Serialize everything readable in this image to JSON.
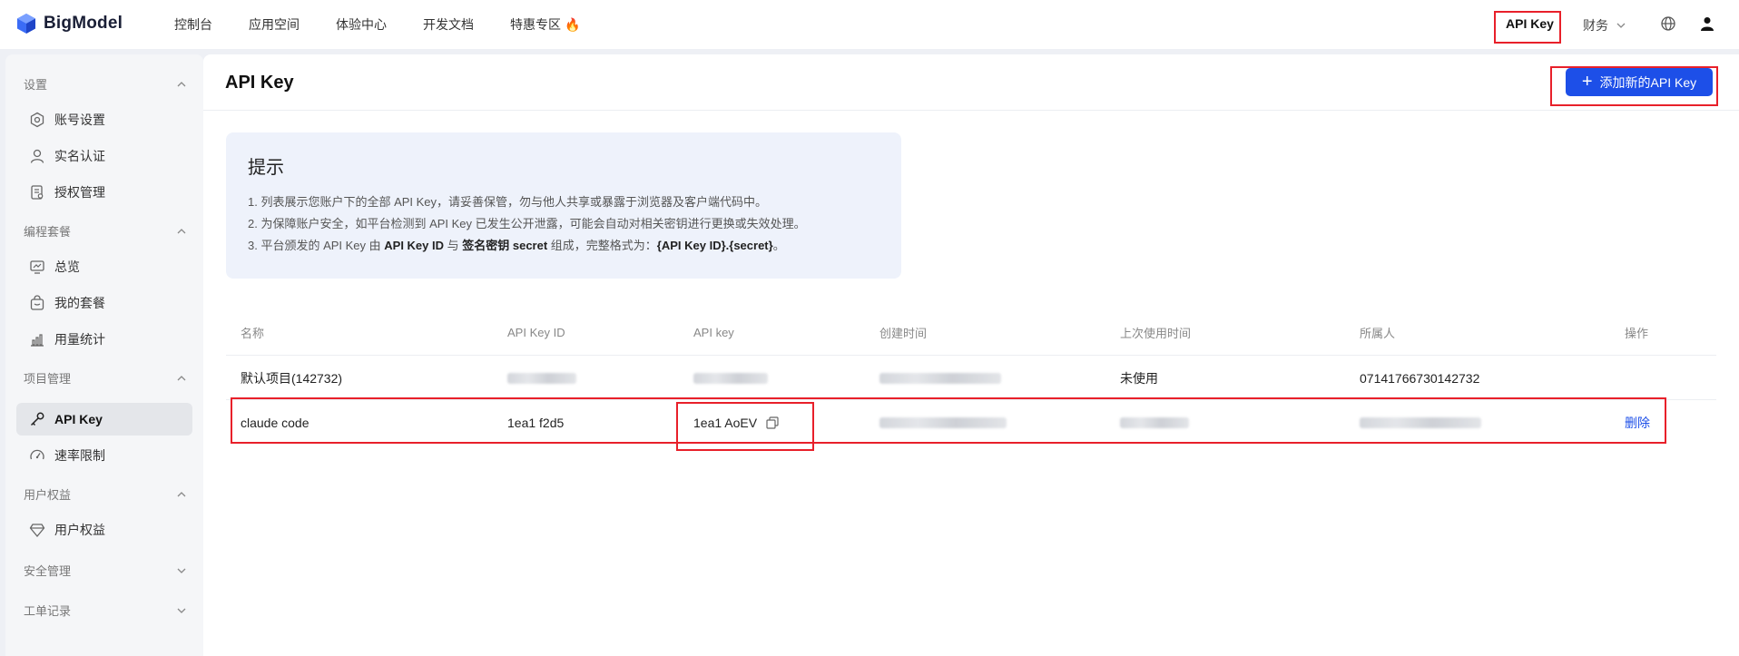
{
  "brand": {
    "name": "BigModel",
    "accent": "#1d4fe8",
    "highlight": "#e8202a"
  },
  "topnav": [
    {
      "label": "控制台"
    },
    {
      "label": "应用空间"
    },
    {
      "label": "体验中心"
    },
    {
      "label": "开发文档"
    },
    {
      "label": "特惠专区",
      "icon": "fire-icon"
    }
  ],
  "topright": {
    "api_key": "API Key",
    "finance": "财务",
    "globe_icon": "globe-icon",
    "user_icon": "user-icon"
  },
  "sidebar": {
    "groups": [
      {
        "label": "设置",
        "expanded": true,
        "items": [
          {
            "label": "账号设置",
            "icon": "gear-icon"
          },
          {
            "label": "实名认证",
            "icon": "person-icon"
          },
          {
            "label": "授权管理",
            "icon": "document-icon"
          }
        ]
      },
      {
        "label": "编程套餐",
        "expanded": true,
        "items": [
          {
            "label": "总览",
            "icon": "monitor-icon"
          },
          {
            "label": "我的套餐",
            "icon": "bag-icon"
          },
          {
            "label": "用量统计",
            "icon": "chart-icon"
          }
        ]
      },
      {
        "label": "项目管理",
        "expanded": true,
        "items": [
          {
            "label": "API Key",
            "icon": "key-icon",
            "active": true
          },
          {
            "label": "速率限制",
            "icon": "gauge-icon"
          }
        ]
      },
      {
        "label": "用户权益",
        "expanded": true,
        "items": [
          {
            "label": "用户权益",
            "icon": "diamond-icon"
          }
        ]
      },
      {
        "label": "安全管理",
        "expanded": false,
        "items": []
      },
      {
        "label": "工单记录",
        "expanded": false,
        "items": []
      }
    ]
  },
  "main": {
    "title": "API Key",
    "add_button": "添加新的API Key",
    "tip": {
      "title": "提示",
      "line1": "1. 列表展示您账户下的全部 API Key，请妥善保管，勿与他人共享或暴露于浏览器及客户端代码中。",
      "line2": "2. 为保障账户安全，如平台检测到 API Key 已发生公开泄露，可能会自动对相关密钥进行更换或失效处理。",
      "line3_a": "3. 平台颁发的 API Key 由 ",
      "line3_b": "API Key ID",
      "line3_c": " 与 ",
      "line3_d": "签名密钥 secret",
      "line3_e": " 组成，完整格式为：",
      "line3_f": "{API Key ID}.{secret}",
      "line3_g": "。"
    },
    "table": {
      "headers": [
        "名称",
        "API Key ID",
        "API key",
        "创建时间",
        "上次使用时间",
        "所属人",
        "操作"
      ],
      "rows": [
        {
          "name": "默认项目(142732)",
          "key_id": "",
          "api_key": "",
          "created": "",
          "last_used": "未使用",
          "owner": "07141766730142732",
          "action": ""
        },
        {
          "name": "claude code",
          "key_id": "1ea1 f2d5",
          "api_key": "1ea1 AoEV",
          "created": "",
          "last_used": "",
          "owner": "",
          "action": "删除"
        }
      ]
    }
  }
}
